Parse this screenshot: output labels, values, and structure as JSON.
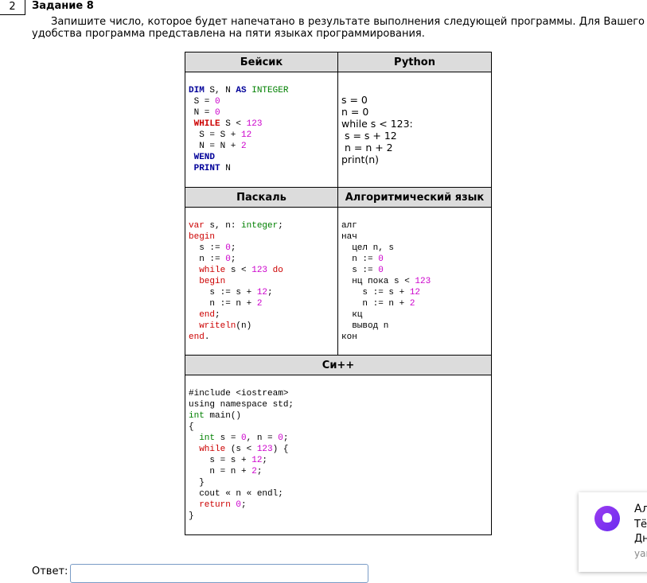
{
  "task": {
    "number": "2",
    "title": "Задание 8",
    "text": "Запишите число, которое будет напечатано в результате выполнения следующей программы. Для Вашего удобства программа представлена на пяти языках программирования."
  },
  "headers": {
    "basic": "Бейсик",
    "python": "Python",
    "pascal": "Паскаль",
    "algo": "Алгоритмический язык",
    "cpp": "Си++"
  },
  "code": {
    "basic": [
      [
        [
          "DIM",
          "k"
        ],
        [
          " S, N ",
          ""
        ],
        [
          "AS",
          "k"
        ],
        [
          " ",
          ""
        ],
        [
          "INTEGER",
          "g"
        ]
      ],
      [
        [
          " S = ",
          ""
        ],
        [
          "0",
          "m"
        ]
      ],
      [
        [
          " N = ",
          ""
        ],
        [
          "0",
          "m"
        ]
      ],
      [
        [
          " ",
          ""
        ],
        [
          "WHILE",
          "rb"
        ],
        [
          " S < ",
          ""
        ],
        [
          "123",
          "m"
        ]
      ],
      [
        [
          "  S = S + ",
          ""
        ],
        [
          "12",
          "m"
        ]
      ],
      [
        [
          "  N = N + ",
          ""
        ],
        [
          "2",
          "m"
        ]
      ],
      [
        [
          " ",
          ""
        ],
        [
          "WEND",
          "k"
        ]
      ],
      [
        [
          " ",
          ""
        ],
        [
          "PRINT",
          "k"
        ],
        [
          " N",
          ""
        ]
      ]
    ],
    "python": [
      [
        [
          "s = 0",
          ""
        ]
      ],
      [
        [
          "n = 0",
          ""
        ]
      ],
      [
        [
          "while s < 123:",
          ""
        ]
      ],
      [
        [
          " s = s + 12",
          ""
        ]
      ],
      [
        [
          " n = n + 2",
          ""
        ]
      ],
      [
        [
          "print(n)",
          ""
        ]
      ]
    ],
    "pascal": [
      [
        [
          "var",
          "r"
        ],
        [
          " s, n: ",
          ""
        ],
        [
          "integer",
          "g"
        ],
        [
          ";",
          ""
        ]
      ],
      [
        [
          "begin",
          "r"
        ]
      ],
      [
        [
          "  s := ",
          ""
        ],
        [
          "0",
          "m"
        ],
        [
          ";",
          ""
        ]
      ],
      [
        [
          "  n := ",
          ""
        ],
        [
          "0",
          "m"
        ],
        [
          ";",
          ""
        ]
      ],
      [
        [
          "  ",
          ""
        ],
        [
          "while",
          "r"
        ],
        [
          " s < ",
          ""
        ],
        [
          "123",
          "m"
        ],
        [
          " ",
          ""
        ],
        [
          "do",
          "r"
        ]
      ],
      [
        [
          "  ",
          ""
        ],
        [
          "begin",
          "r"
        ]
      ],
      [
        [
          "    s := s + ",
          ""
        ],
        [
          "12",
          "m"
        ],
        [
          ";",
          ""
        ]
      ],
      [
        [
          "    n := n + ",
          ""
        ],
        [
          "2",
          "m"
        ]
      ],
      [
        [
          "  ",
          ""
        ],
        [
          "end",
          "r"
        ],
        [
          ";",
          ""
        ]
      ],
      [
        [
          "  ",
          ""
        ],
        [
          "writeln",
          "r"
        ],
        [
          "(n)",
          ""
        ]
      ],
      [
        [
          "end",
          "r"
        ],
        [
          ".",
          ""
        ]
      ]
    ],
    "algo": [
      [
        [
          "алг",
          ""
        ]
      ],
      [
        [
          "нач",
          ""
        ]
      ],
      [
        [
          "  цел n, s",
          ""
        ]
      ],
      [
        [
          "  n := ",
          ""
        ],
        [
          "0",
          "m"
        ]
      ],
      [
        [
          "  s := ",
          ""
        ],
        [
          "0",
          "m"
        ]
      ],
      [
        [
          "  нц пока s < ",
          ""
        ],
        [
          "123",
          "m"
        ]
      ],
      [
        [
          "    s := s + ",
          ""
        ],
        [
          "12",
          "m"
        ]
      ],
      [
        [
          "    n := n + ",
          ""
        ],
        [
          "2",
          "m"
        ]
      ],
      [
        [
          "  кц",
          ""
        ]
      ],
      [
        [
          "  вывод n",
          ""
        ]
      ],
      [
        [
          "кон",
          ""
        ]
      ]
    ],
    "cpp": [
      [
        [
          "#include <iostream>",
          ""
        ]
      ],
      [
        [
          "using namespace std;",
          ""
        ]
      ],
      [
        [
          "int",
          "g"
        ],
        [
          " main()",
          ""
        ]
      ],
      [
        [
          "{",
          ""
        ]
      ],
      [
        [
          "  ",
          ""
        ],
        [
          "int",
          "g"
        ],
        [
          " s = ",
          ""
        ],
        [
          "0",
          "m"
        ],
        [
          ", n = ",
          ""
        ],
        [
          "0",
          "m"
        ],
        [
          ";",
          ""
        ]
      ],
      [
        [
          "  ",
          ""
        ],
        [
          "while",
          "r"
        ],
        [
          " (s < ",
          ""
        ],
        [
          "123",
          "m"
        ],
        [
          ") {",
          ""
        ]
      ],
      [
        [
          "    s = s + ",
          ""
        ],
        [
          "12",
          "m"
        ],
        [
          ";",
          ""
        ]
      ],
      [
        [
          "    n = n + ",
          ""
        ],
        [
          "2",
          "m"
        ],
        [
          ";",
          ""
        ]
      ],
      [
        [
          "  }",
          ""
        ]
      ],
      [
        [
          "  cout « n « endl;",
          ""
        ]
      ],
      [
        [
          "  ",
          ""
        ],
        [
          "return",
          "r"
        ],
        [
          " ",
          ""
        ],
        [
          "0",
          "m"
        ],
        [
          ";",
          ""
        ]
      ],
      [
        [
          "}",
          ""
        ]
      ]
    ]
  },
  "answer": {
    "label": "Ответ:",
    "value": ""
  },
  "notification": {
    "title": "Ал",
    "line1": "Тё",
    "line2": "Дн",
    "source": "yar"
  }
}
